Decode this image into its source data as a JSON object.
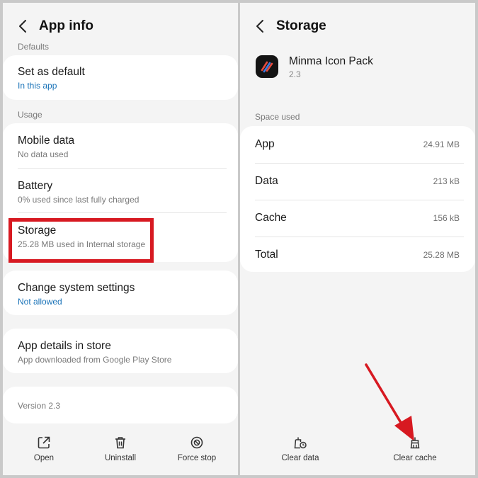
{
  "left": {
    "header": {
      "title": "App info"
    },
    "sections": {
      "defaults_label": "Defaults",
      "usage_label": "Usage"
    },
    "set_default": {
      "title": "Set as default",
      "subtitle": "In this app"
    },
    "mobile_data": {
      "title": "Mobile data",
      "subtitle": "No data used"
    },
    "battery": {
      "title": "Battery",
      "subtitle": "0% used since last fully charged"
    },
    "storage": {
      "title": "Storage",
      "subtitle": "25.28 MB used in Internal storage"
    },
    "change_system": {
      "title": "Change system settings",
      "subtitle": "Not allowed"
    },
    "app_details": {
      "title": "App details in store",
      "subtitle": "App downloaded from Google Play Store"
    },
    "version": "Version 2.3",
    "actions": {
      "open": "Open",
      "uninstall": "Uninstall",
      "force_stop": "Force stop"
    }
  },
  "right": {
    "header": {
      "title": "Storage"
    },
    "app": {
      "name": "Minma Icon Pack",
      "version": "2.3"
    },
    "space_used_label": "Space used",
    "rows": [
      {
        "label": "App",
        "value": "24.91 MB"
      },
      {
        "label": "Data",
        "value": "213 kB"
      },
      {
        "label": "Cache",
        "value": "156 kB"
      },
      {
        "label": "Total",
        "value": "25.28 MB"
      }
    ],
    "actions": {
      "clear_data": "Clear data",
      "clear_cache": "Clear cache"
    }
  },
  "colors": {
    "highlight": "#d71921",
    "arrow": "#d71921",
    "link_blue": "#1a73b8",
    "card_bg": "#ffffff",
    "screen_bg": "#f4f4f4"
  },
  "icons": {
    "back": "chevron-left-icon",
    "open": "open-external-icon",
    "uninstall": "trash-icon",
    "force_stop": "stop-circle-icon",
    "clear_data": "clear-data-icon",
    "clear_cache": "broom-icon"
  }
}
